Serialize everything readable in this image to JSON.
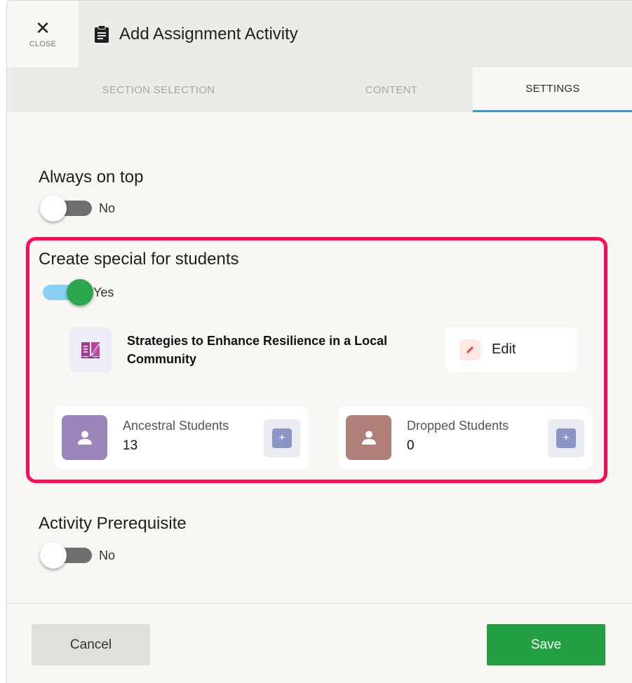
{
  "header": {
    "close_label": "CLOSE",
    "close_glyph": "✕",
    "title": "Add Assignment Activity",
    "title_icon": "clipboard-icon"
  },
  "tabs": [
    {
      "label": "SECTION SELECTION",
      "active": false
    },
    {
      "label": "CONTENT",
      "active": false
    },
    {
      "label": "SETTINGS",
      "active": true
    }
  ],
  "settings": {
    "always_on_top": {
      "title": "Always on top",
      "state_label": "No",
      "on": false
    },
    "special_for_students": {
      "title": "Create special for students",
      "state_label": "Yes",
      "on": true,
      "course": {
        "title": "Strategies to Enhance Resilience in a Local Community",
        "icon": "book-edit-icon"
      },
      "edit_label": "Edit",
      "ancestral": {
        "label": "Ancestral Students",
        "count": "13",
        "add_glyph": "+"
      },
      "dropped": {
        "label": "Dropped Students",
        "count": "0",
        "add_glyph": "+"
      }
    },
    "activity_prerequisite": {
      "title": "Activity Prerequisite",
      "state_label": "No",
      "on": false
    }
  },
  "footer": {
    "cancel_label": "Cancel",
    "save_label": "Save"
  },
  "colors": {
    "accent_tab": "#3a94d8",
    "highlight_border": "#ff0a5a",
    "save_green": "#23a043",
    "toggle_on_knob": "#2ca64a",
    "ancestral_avatar": "#9a86b8",
    "dropped_avatar": "#b07f7a"
  }
}
